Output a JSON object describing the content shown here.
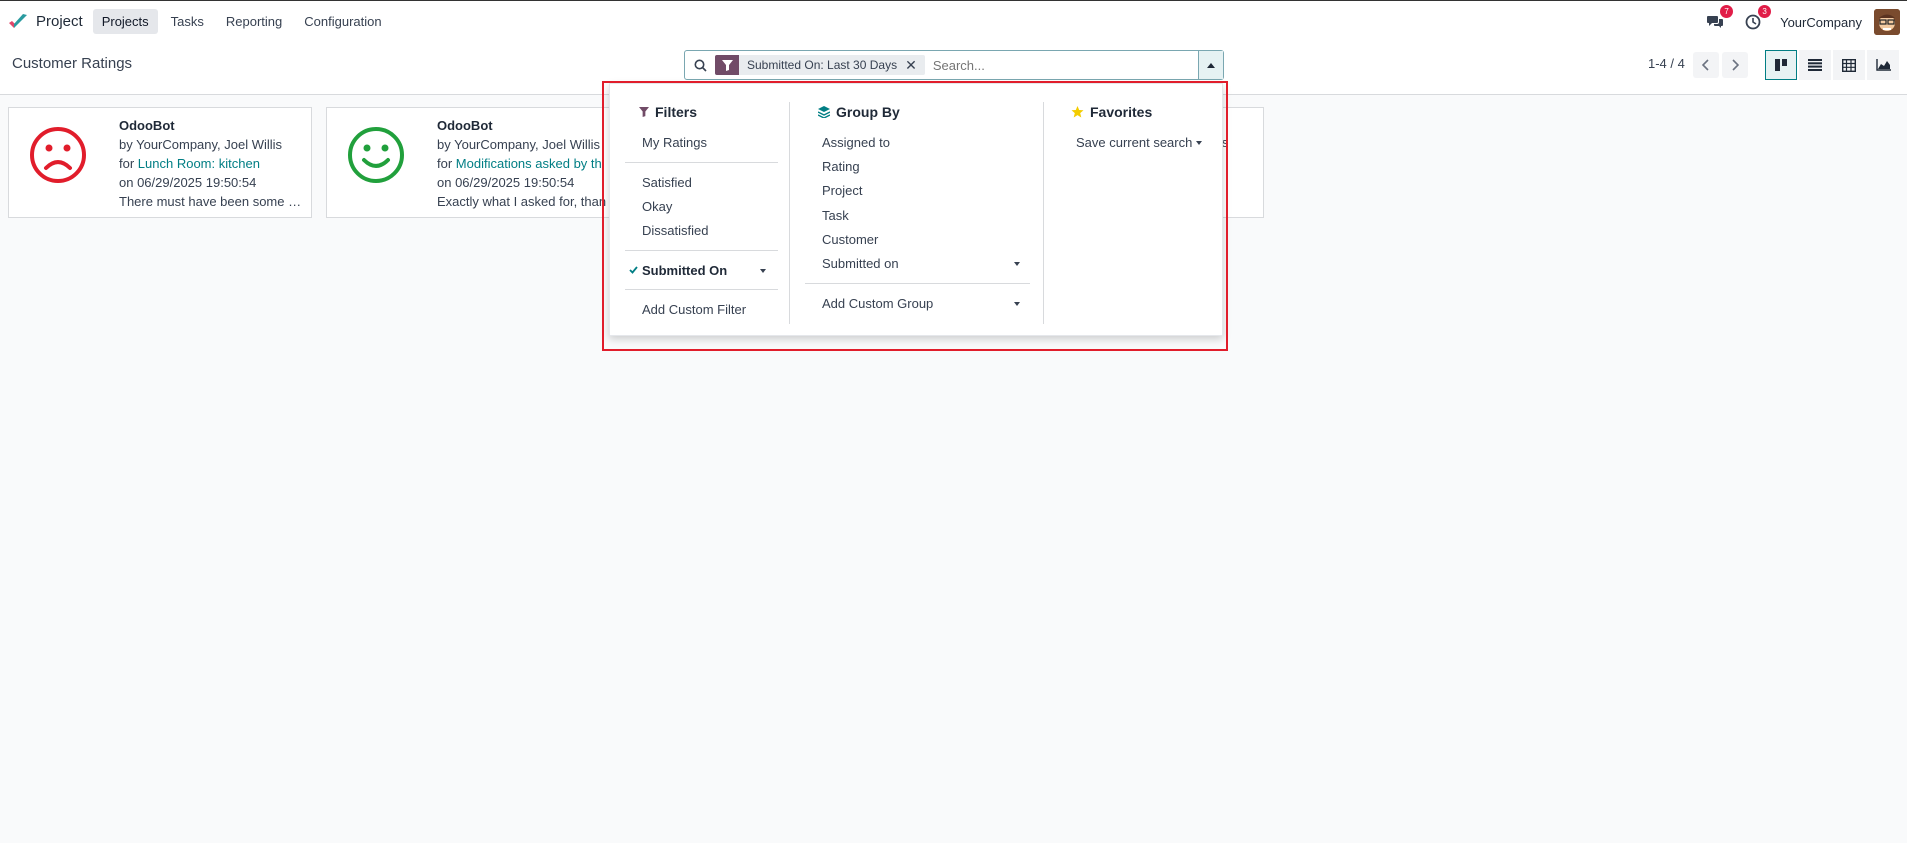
{
  "navbar": {
    "app_name": "Project",
    "menu": [
      "Projects",
      "Tasks",
      "Reporting",
      "Configuration"
    ],
    "messages_count": "7",
    "activities_count": "3",
    "company": "YourCompany"
  },
  "control": {
    "title": "Customer Ratings",
    "facet_label": "Submitted On: Last 30 Days",
    "search_placeholder": "Search...",
    "pager": "1-4 / 4",
    "views": [
      "kanban",
      "list",
      "pivot",
      "graph"
    ]
  },
  "cards": [
    {
      "rating": "dissatisfied",
      "author": "OdooBot",
      "by": "by YourCompany, Joel Willis",
      "for_prefix": "for ",
      "for_link": "Lunch Room: kitchen",
      "date": "on 06/29/2025 19:50:54",
      "comment": "There must have been some …"
    },
    {
      "rating": "satisfied",
      "author": "OdooBot",
      "by": "by YourCompany, Joel Willis",
      "for_prefix": "for ",
      "for_link": "Modifications asked by th",
      "date": "on 06/29/2025 19:50:54",
      "comment": "Exactly what I asked for, than"
    }
  ],
  "dropdown": {
    "filters": {
      "heading": "Filters",
      "my_ratings": "My Ratings",
      "satisfied": "Satisfied",
      "okay": "Okay",
      "dissatisfied": "Dissatisfied",
      "submitted_on": "Submitted On",
      "add_custom": "Add Custom Filter"
    },
    "groupby": {
      "heading": "Group By",
      "assigned_to": "Assigned to",
      "rating": "Rating",
      "project": "Project",
      "task": "Task",
      "customer": "Customer",
      "submitted_on": "Submitted on",
      "add_custom": "Add Custom Group"
    },
    "favorites": {
      "heading": "Favorites",
      "save_current": "Save current search"
    },
    "peek_text": "is"
  },
  "colors": {
    "accent": "#017e84",
    "brand": "#714b67",
    "negative": "#e11d2b",
    "positive": "#21a03c",
    "badge": "#e11d48"
  }
}
